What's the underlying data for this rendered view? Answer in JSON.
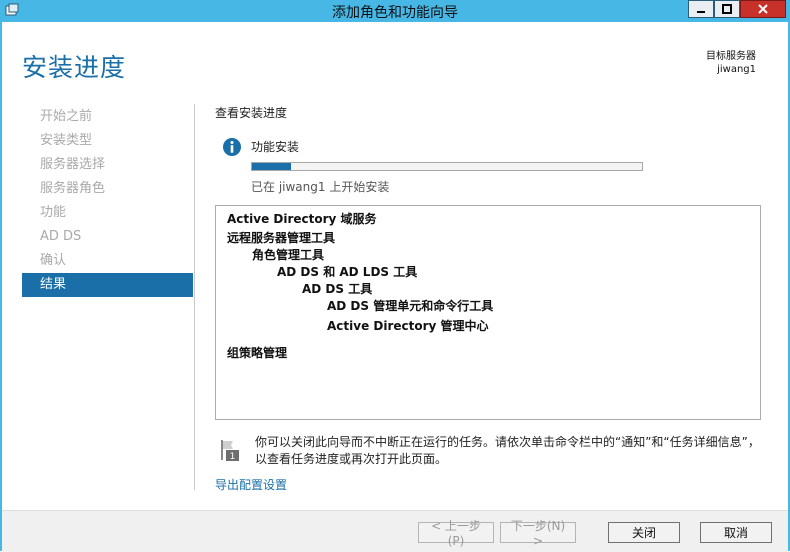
{
  "window": {
    "title": "添加角色和功能向导"
  },
  "header": {
    "page_title": "安装进度",
    "dest_label": "目标服务器",
    "dest_server": "jiwang1"
  },
  "sidebar": {
    "items": [
      {
        "label": "开始之前",
        "active": false
      },
      {
        "label": "安装类型",
        "active": false
      },
      {
        "label": "服务器选择",
        "active": false
      },
      {
        "label": "服务器角色",
        "active": false
      },
      {
        "label": "功能",
        "active": false
      },
      {
        "label": "AD DS",
        "active": false
      },
      {
        "label": "确认",
        "active": false
      },
      {
        "label": "结果",
        "active": true
      }
    ]
  },
  "main": {
    "section_label": "查看安装进度",
    "feature_label": "功能安装",
    "progress": 0.1,
    "status_text": "已在 jiwang1 上开始安装",
    "results": [
      {
        "text": "Active Directory 域服务",
        "level": 0
      },
      {
        "text": "远程服务器管理工具",
        "level": 0
      },
      {
        "text": "角色管理工具",
        "level": 1
      },
      {
        "text": "AD DS 和 AD LDS 工具",
        "level": 2
      },
      {
        "text": "AD DS 工具",
        "level": 3
      },
      {
        "text": "AD DS 管理单元和命令行工具",
        "level": 4
      },
      {
        "text": "Active Directory 管理中心",
        "level": 4
      },
      {
        "text": "组策略管理",
        "level": 0
      }
    ],
    "flag_number": "1",
    "note_text": "你可以关闭此向导而不中断正在运行的任务。请依次单击命令栏中的“通知”和“任务详细信息”，以查看任务进度或再次打开此页面。",
    "export_link": "导出配置设置"
  },
  "footer": {
    "prev_label": "< 上一步(P)",
    "next_label": "下一步(N) >",
    "close_label": "关闭",
    "cancel_label": "取消"
  },
  "colors": {
    "accent": "#1a6fa8",
    "titlebar": "#47b7e6"
  }
}
